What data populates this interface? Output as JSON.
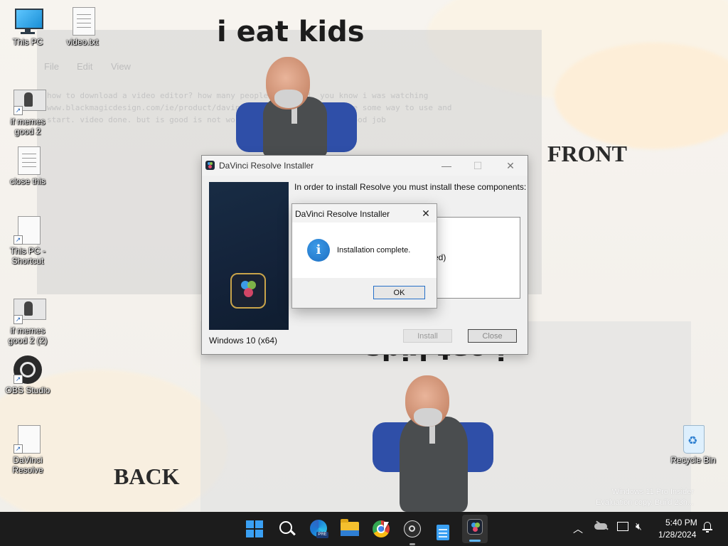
{
  "wallpaper": {
    "meme_title_top": "i eat kids",
    "meme_title_mirrored": "i eat kids",
    "label_front": "FRONT",
    "label_back": "BACK"
  },
  "ghost_notepad": {
    "menu": [
      "File",
      "Edit",
      "View"
    ],
    "lines": [
      "how to download a video editor? how many people download. you know i was watching",
      "www.blackmagicdesign.com/ie/product/davinciresolve/ then. is there some way to use and",
      "start. video done. but is good is not working. still taking ... good job"
    ]
  },
  "desktop_icons": [
    {
      "name": "This PC",
      "kind": "monitor"
    },
    {
      "name": "video.txt",
      "kind": "text"
    },
    {
      "name": "if memes good 2",
      "kind": "image-shortcut"
    },
    {
      "name": "close this",
      "kind": "text"
    },
    {
      "name": "This PC - Shortcut",
      "kind": "blank-shortcut"
    },
    {
      "name": "if memes good 2 (2)",
      "kind": "image-shortcut"
    },
    {
      "name": "OBS Studio",
      "kind": "obs-shortcut"
    },
    {
      "name": "DaVinci Resolve",
      "kind": "blank-shortcut"
    },
    {
      "name": "Recycle Bin",
      "kind": "recycle"
    }
  ],
  "installer": {
    "title": "DaVinci Resolve Installer",
    "prompt": "In order to install Resolve you must install these components:",
    "partial_item": "ed)",
    "platform": "Windows 10 (x64)",
    "install_label": "Install",
    "close_label": "Close",
    "minimize_glyph": "—",
    "maximize_glyph": "☐",
    "close_glyph": "✕"
  },
  "message_box": {
    "title": "DaVinci Resolve Installer",
    "message": "Installation complete.",
    "ok_label": "OK",
    "close_glyph": "✕",
    "icon": "info-icon"
  },
  "watermark": {
    "line1": "Windows 11 Pro Insider",
    "line2": "Evaluation copy. Build 23h..."
  },
  "taskbar": {
    "pinned": [
      "start-icon",
      "search-icon",
      "edge-beta-icon",
      "file-explorer-icon",
      "chrome-icon",
      "obs-icon",
      "notepad-icon",
      "davinci-resolve-icon"
    ],
    "time": "5:40 PM",
    "date": "1/28/2024",
    "colors": {
      "background": "#1c1c1c",
      "start_blue": "#3aa0f3"
    }
  }
}
